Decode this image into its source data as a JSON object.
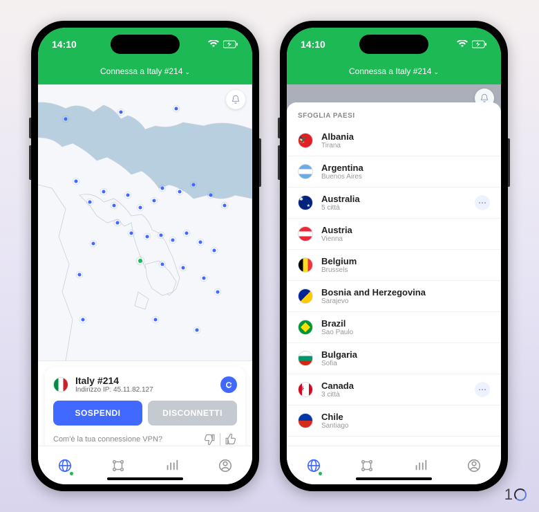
{
  "status": {
    "time": "14:10"
  },
  "header": {
    "connected_text": "Connessa a Italy #214"
  },
  "connection": {
    "server_name": "Italy #214",
    "ip_label": "Indirizzo IP: 45.11.82.127",
    "pause_btn": "SOSPENDI",
    "disconnect_btn": "DISCONNETTI",
    "feedback_prompt": "Com'è la tua connessione VPN?"
  },
  "countries": {
    "header": "SFOGLIA PAESI",
    "list": [
      {
        "name": "Albania",
        "sub": "Tirana",
        "flag": "albania",
        "more": false
      },
      {
        "name": "Argentina",
        "sub": "Buenos Aires",
        "flag": "argentina",
        "more": false
      },
      {
        "name": "Australia",
        "sub": "5 città",
        "flag": "australia",
        "more": true
      },
      {
        "name": "Austria",
        "sub": "Vienna",
        "flag": "austria",
        "more": false
      },
      {
        "name": "Belgium",
        "sub": "Brussels",
        "flag": "belgium",
        "more": false
      },
      {
        "name": "Bosnia and Herzegovina",
        "sub": "Sarajevo",
        "flag": "bosnia",
        "more": false
      },
      {
        "name": "Brazil",
        "sub": "Sao Paulo",
        "flag": "brazil",
        "more": false
      },
      {
        "name": "Bulgaria",
        "sub": "Sofia",
        "flag": "bulgaria",
        "more": false
      },
      {
        "name": "Canada",
        "sub": "3 città",
        "flag": "canada",
        "more": true
      },
      {
        "name": "Chile",
        "sub": "Santiago",
        "flag": "chile",
        "more": false
      }
    ]
  },
  "logo": {
    "text": "1"
  }
}
